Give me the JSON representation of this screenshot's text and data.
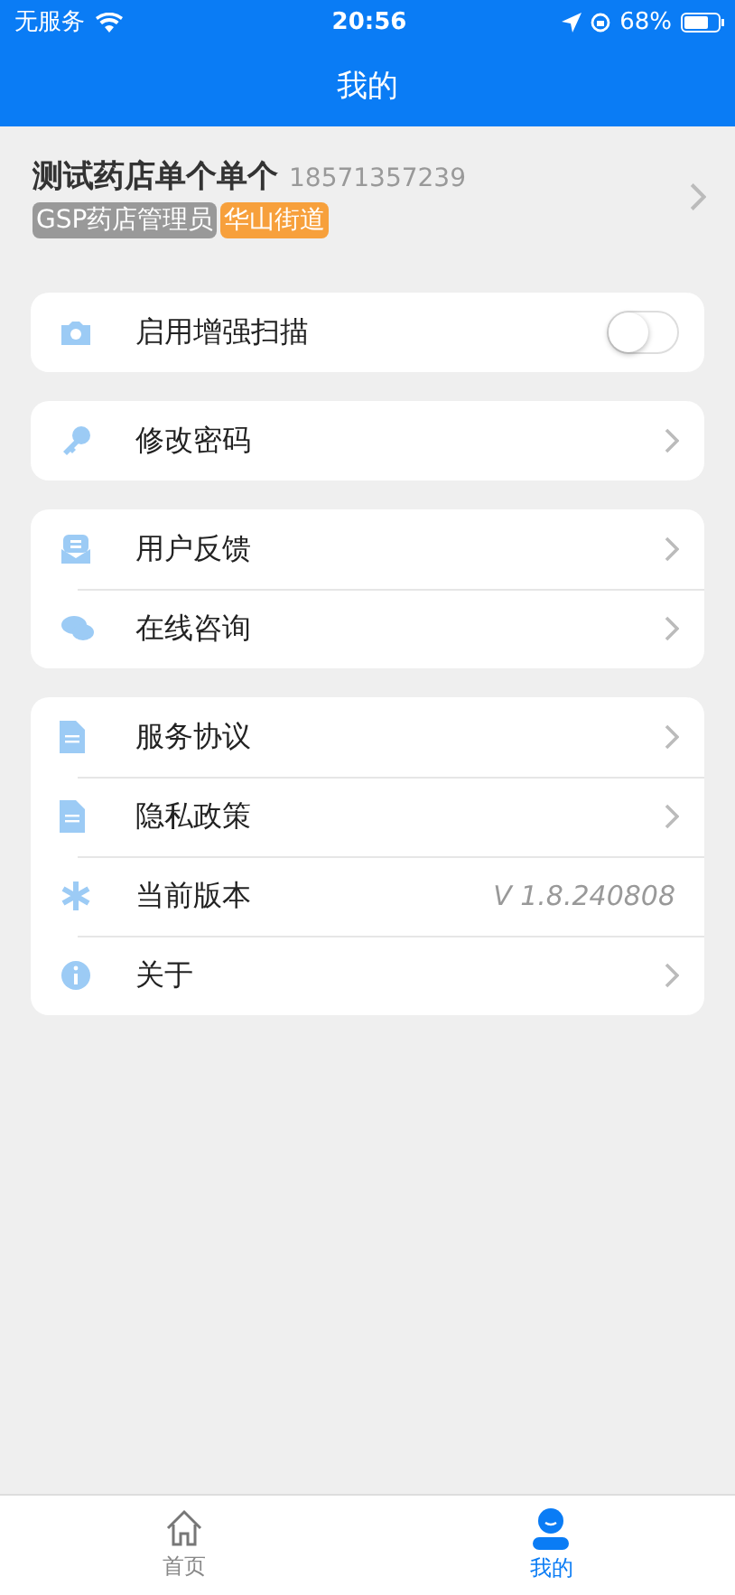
{
  "status_bar": {
    "carrier": "无服务",
    "time": "20:56",
    "battery": "68%"
  },
  "nav": {
    "title": "我的"
  },
  "profile": {
    "name": "测试药店单个单个",
    "phone": "18571357239",
    "tags": [
      {
        "label": "GSP药店管理员",
        "color": "#999999"
      },
      {
        "label": "华山街道",
        "color": "#f7a03c"
      }
    ]
  },
  "groups": [
    {
      "items": [
        {
          "kind": "toggle",
          "label": "启用增强扫描",
          "on": false
        }
      ]
    },
    {
      "items": [
        {
          "kind": "link",
          "label": "修改密码"
        }
      ]
    },
    {
      "items": [
        {
          "kind": "link",
          "label": "用户反馈"
        },
        {
          "kind": "link",
          "label": "在线咨询"
        }
      ]
    },
    {
      "items": [
        {
          "kind": "link",
          "label": "服务协议"
        },
        {
          "kind": "link",
          "label": "隐私政策"
        },
        {
          "kind": "value",
          "label": "当前版本",
          "value": "V 1.8.240808"
        },
        {
          "kind": "link",
          "label": "关于"
        }
      ]
    }
  ],
  "tab_bar": [
    {
      "label": "首页",
      "selected": false
    },
    {
      "label": "我的",
      "selected": true
    }
  ]
}
